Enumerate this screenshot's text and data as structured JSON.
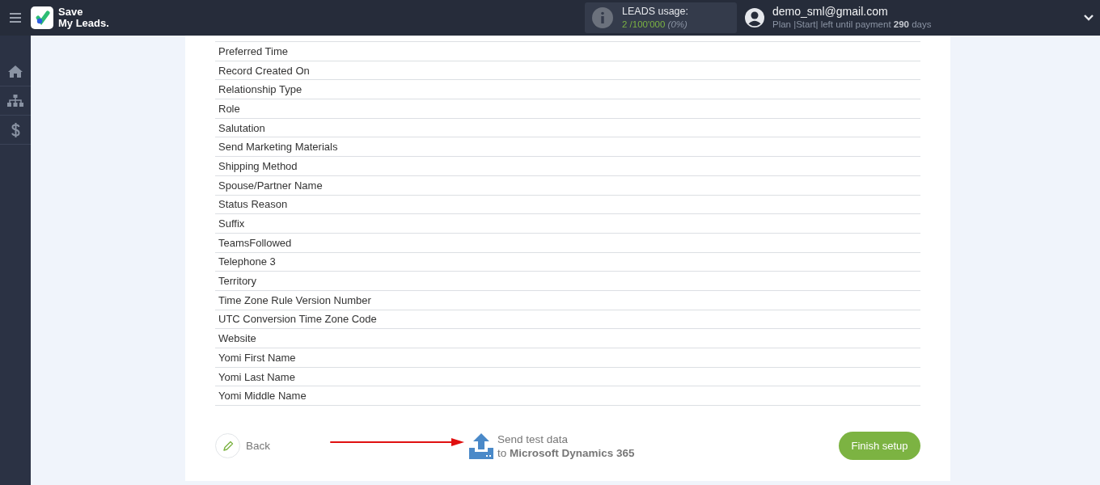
{
  "header": {
    "logo_lines": [
      "Save",
      "My Leads."
    ],
    "usage": {
      "label": "LEADS usage:",
      "count": "2 /100'000",
      "percent": "(0%)"
    },
    "user": {
      "email": "demo_sml@gmail.com",
      "plan": "Plan |Start| left until payment **290** days"
    }
  },
  "sidebar": {
    "items": [
      {
        "kind": "home"
      },
      {
        "kind": "tree"
      },
      {
        "kind": "dollar"
      }
    ]
  },
  "fields": [
    "Preferred Time",
    "Record Created On",
    "Relationship Type",
    "Role",
    "Salutation",
    "Send Marketing Materials",
    "Shipping Method",
    "Spouse/Partner Name",
    "Status Reason",
    "Suffix",
    "TeamsFollowed",
    "Telephone 3",
    "Territory",
    "Time Zone Rule Version Number",
    "UTC Conversion Time Zone Code",
    "Website",
    "Yomi First Name",
    "Yomi Last Name",
    "Yomi Middle Name"
  ],
  "footer": {
    "back": "Back",
    "send_line1": "Send test data",
    "send_line2": "to **Microsoft Dynamics 365**",
    "finish": "Finish setup"
  }
}
